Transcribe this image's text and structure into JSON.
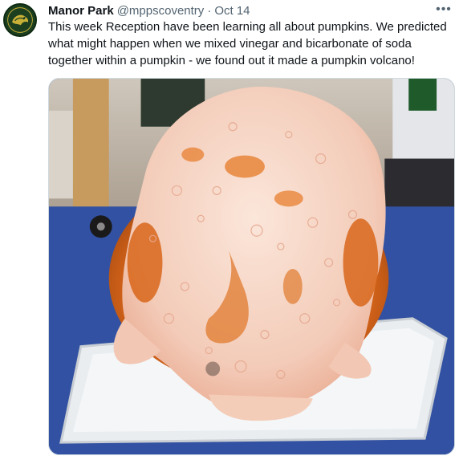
{
  "tweet": {
    "author_name": "Manor Park",
    "handle": "@mppscoventry",
    "separator": "·",
    "date": "Oct 14",
    "more_label": "•••",
    "text": "This week Reception have been learning all about pumpkins. We predicted what might happen when we mixed vinegar and bicarbonate of soda together within a pumpkin - we found out it made a pumpkin volcano!"
  },
  "media": {
    "subject": "pumpkin volcano foaming over a white tray on a blue carpet"
  },
  "colors": {
    "handle_gray": "#536471",
    "border": "#cfd9de",
    "avatar_green": "#1c3f1f",
    "avatar_gold": "#c9b037"
  },
  "icons": {
    "more": "ellipsis-icon"
  }
}
